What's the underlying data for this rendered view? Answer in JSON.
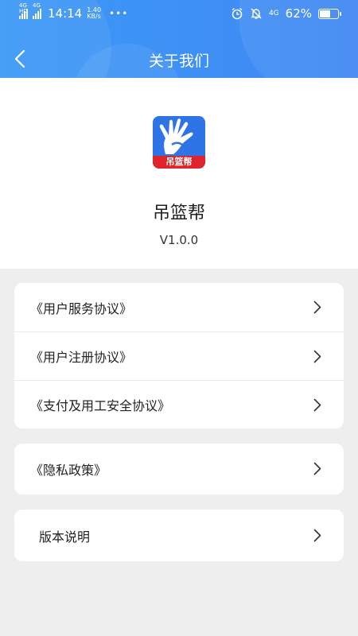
{
  "status_bar": {
    "signal_1_tag": "4G HD",
    "signal_2_tag": "4G",
    "time": "14:14",
    "speed_value": "1.40",
    "speed_unit": "KB/s",
    "more": "•••",
    "network": "4G",
    "battery_text": "62%",
    "battery_level": 0.62
  },
  "nav": {
    "title": "关于我们"
  },
  "app": {
    "logo_text": "吊篮帮",
    "name": "吊篮帮",
    "version": "V1.0.0",
    "brand_blue": "#2f74e6",
    "brand_red": "#e0242b"
  },
  "agreements": [
    {
      "label": "《用户服务协议》"
    },
    {
      "label": "《用户注册协议》"
    },
    {
      "label": "《支付及用工安全协议》"
    }
  ],
  "privacy": {
    "label": "《隐私政策》"
  },
  "version_info": {
    "label": "版本说明"
  },
  "colors": {
    "header_gradient_start": "#3a98f6",
    "header_gradient_end": "#3f86f3",
    "page_background": "#eeeeee"
  }
}
